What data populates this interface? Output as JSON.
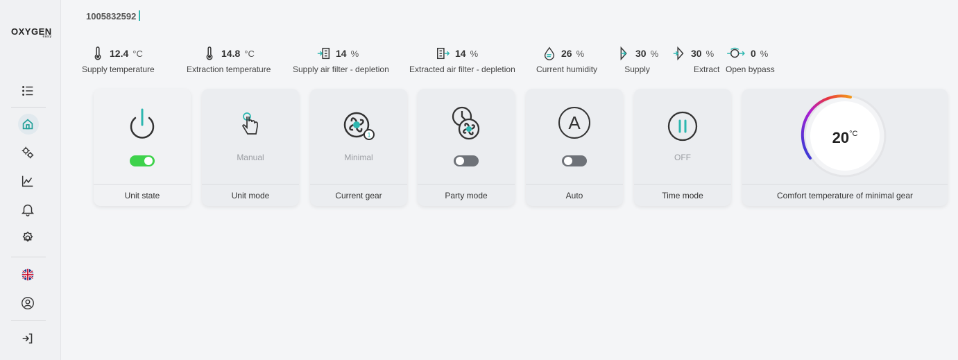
{
  "logo": {
    "text": "OXYGEN",
    "sub": "easy"
  },
  "serial": "1005832592",
  "metrics": [
    {
      "value": "12.4",
      "unit": "°C",
      "label": "Supply temperature",
      "icon": "thermometer-icon"
    },
    {
      "value": "14.8",
      "unit": "°C",
      "label": "Extraction temperature",
      "icon": "thermometer-icon"
    },
    {
      "value": "14",
      "unit": "%",
      "label": "Supply air filter - depletion",
      "icon": "filter-supply-icon"
    },
    {
      "value": "14",
      "unit": "%",
      "label": "Extracted air filter - depletion",
      "icon": "filter-extract-icon"
    },
    {
      "value": "26",
      "unit": "%",
      "label": "Current humidity",
      "icon": "humidity-icon"
    },
    {
      "value": "30",
      "unit": "%",
      "label": "Supply",
      "icon": "supply-icon"
    },
    {
      "value": "30",
      "unit": "%",
      "label": "Extract",
      "icon": "extract-icon"
    },
    {
      "value": "0",
      "unit": "%",
      "label": "Open bypass",
      "icon": "bypass-icon"
    }
  ],
  "cards": {
    "unit_state": {
      "label": "Unit state",
      "toggle_on": true
    },
    "unit_mode": {
      "label": "Unit mode",
      "status": "Manual"
    },
    "current_gear": {
      "label": "Current gear",
      "status": "Minimal"
    },
    "party_mode": {
      "label": "Party mode",
      "toggle_on": false
    },
    "auto": {
      "label": "Auto",
      "toggle_on": false,
      "letter": "A"
    },
    "time_mode": {
      "label": "Time mode",
      "status": "OFF"
    },
    "comfort": {
      "label": "Comfort temperature of minimal gear",
      "value": "20",
      "unit": "°C"
    }
  },
  "colors": {
    "accent": "#2db7b0",
    "toggle_on": "#3ed24b",
    "toggle_off": "#6e7278"
  }
}
